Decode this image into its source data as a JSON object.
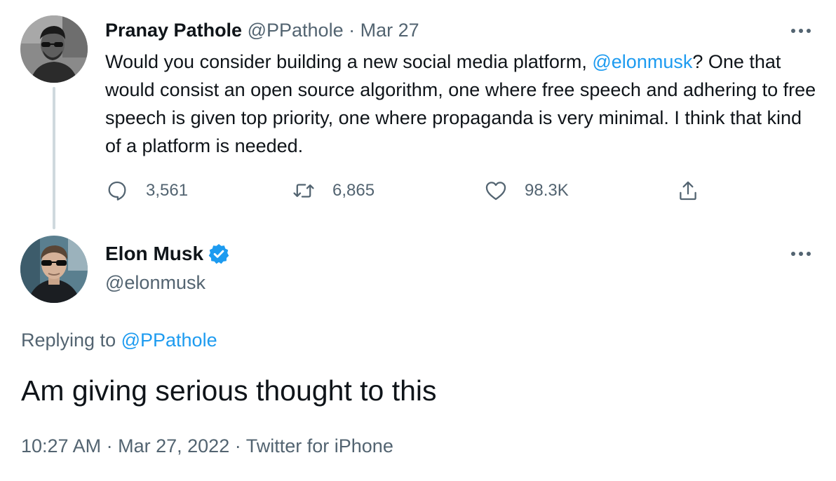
{
  "tweet1": {
    "display_name": "Pranay Pathole",
    "handle": "@PPathole",
    "separator": "·",
    "date": "Mar 27",
    "avatar_icon": "profile-photo-icon",
    "text_part1": "Would you consider building a new social media platform, ",
    "mention": "@elonmusk",
    "text_part2": "? One that would consist an open source algorithm, one where free speech and adhering to free speech is given top priority, one where propaganda is very minimal. I think that kind of a platform is needed.",
    "more_icon": "more-options-icon",
    "actions": {
      "reply_count": "3,561",
      "retweet_count": "6,865",
      "like_count": "98.3K",
      "reply_icon": "reply-icon",
      "retweet_icon": "retweet-icon",
      "like_icon": "heart-icon",
      "share_icon": "share-icon"
    }
  },
  "tweet2": {
    "display_name": "Elon Musk",
    "verified_icon": "verified-badge-icon",
    "handle": "@elonmusk",
    "avatar_icon": "profile-photo-icon",
    "more_icon": "more-options-icon",
    "replying_prefix": "Replying to ",
    "replying_handle": "@PPathole",
    "text": "Am giving serious thought to this",
    "time": "10:27 AM",
    "date": "Mar 27, 2022",
    "separator": "·",
    "source": "Twitter for iPhone"
  },
  "colors": {
    "text_primary": "#0f1419",
    "text_secondary": "#536471",
    "accent": "#1d9bf0",
    "thread_line": "#cfd9de"
  }
}
